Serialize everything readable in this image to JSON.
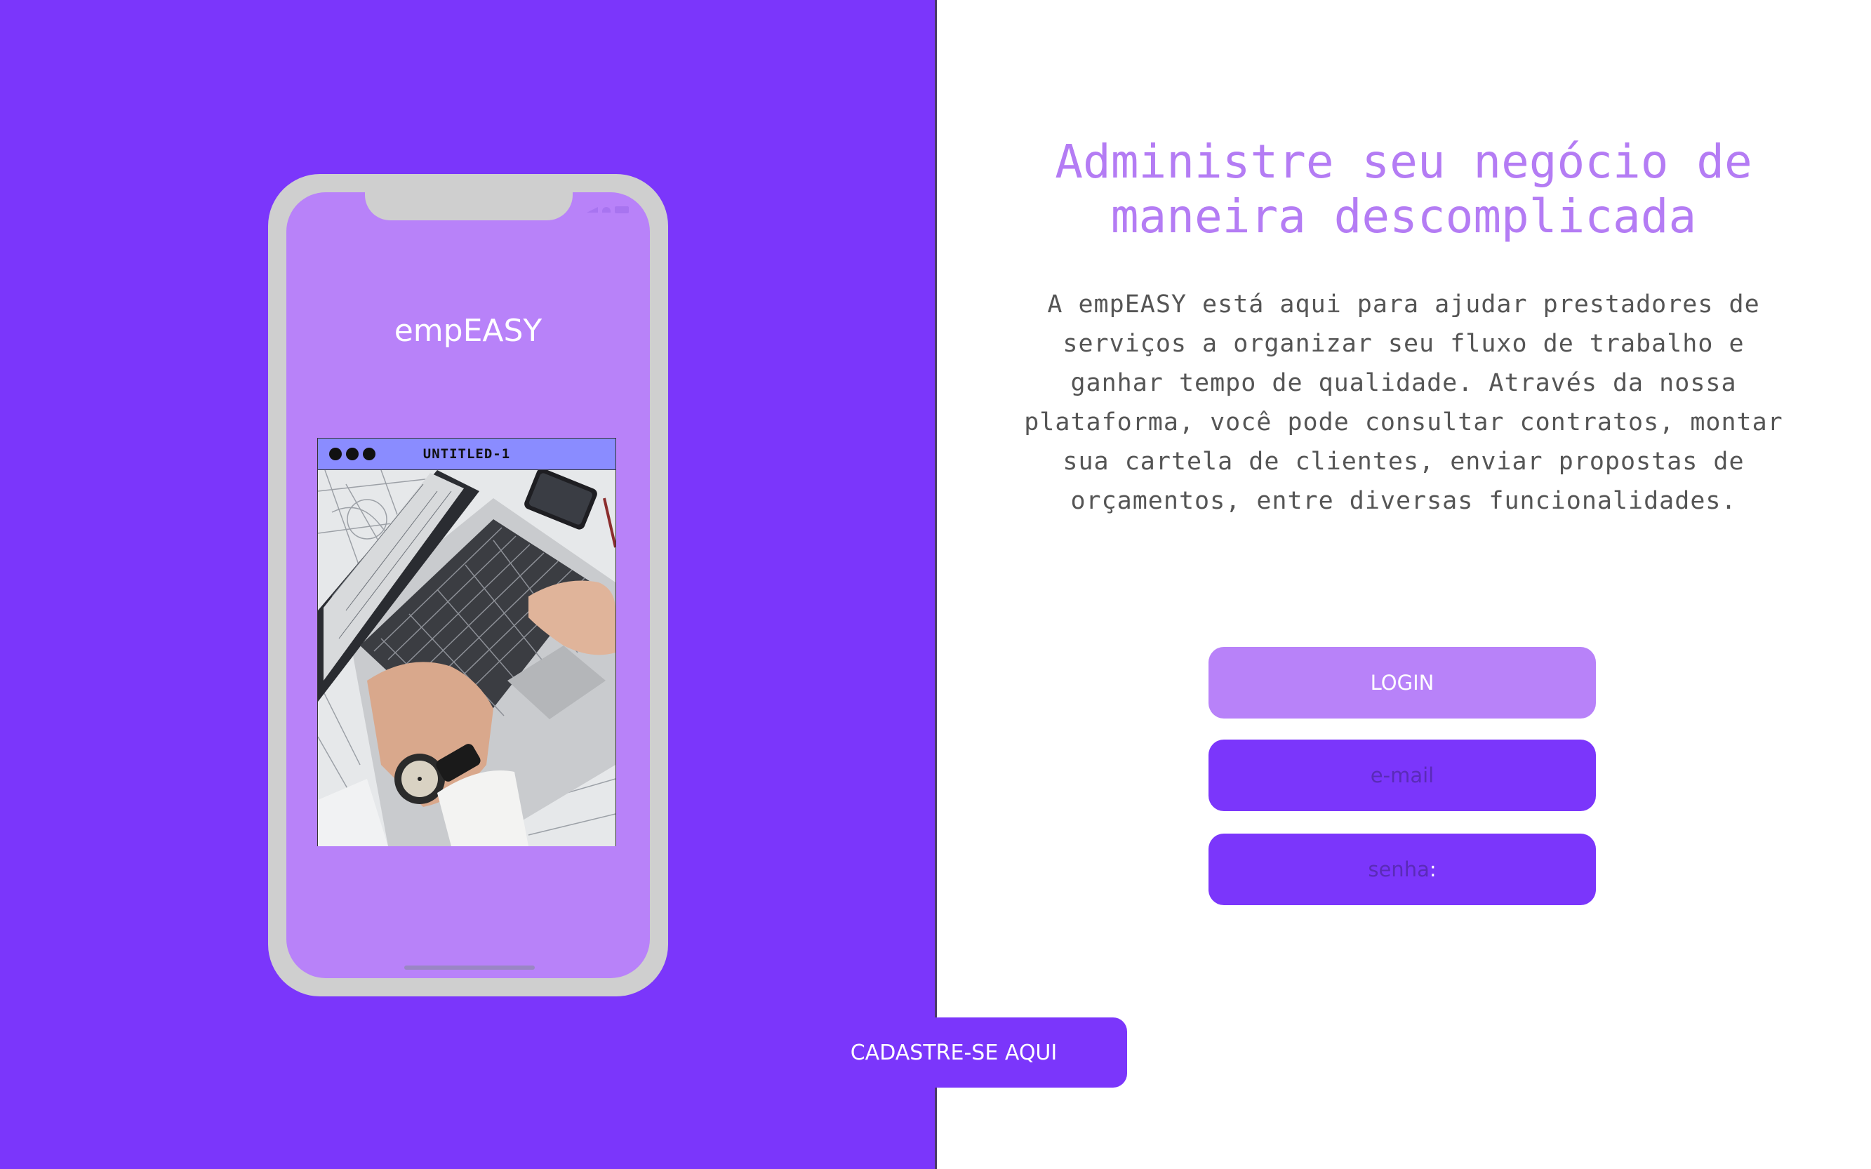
{
  "phone": {
    "app_name": "empEASY",
    "window_title": "UNTITLED-1"
  },
  "main": {
    "headline": "Administre seu negócio de maneira descomplicada",
    "description": "A empEASY está aqui para ajudar prestadores de serviços a organizar seu fluxo de trabalho e ganhar tempo de qualidade. Através da nossa plataforma, você pode consultar contratos, montar sua cartela de clientes, enviar propostas de orçamentos, entre diversas funcionalidades."
  },
  "form": {
    "login_label": "LOGIN",
    "email_placeholder": "e-mail",
    "senha_placeholder": "senha",
    "senha_suffix": ":"
  },
  "signup": {
    "label": "CADASTRE-SE AQUI"
  },
  "colors": {
    "brand_purple": "#7b36fb",
    "light_purple": "#b882f9",
    "headline_purple": "#b47cf4"
  }
}
